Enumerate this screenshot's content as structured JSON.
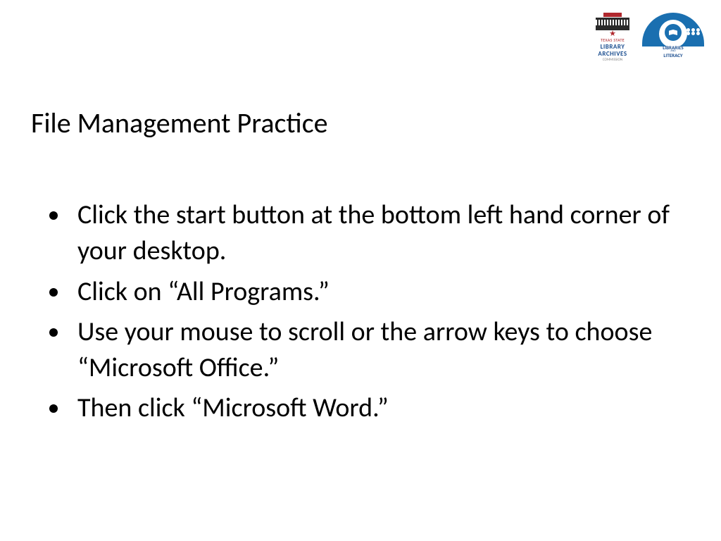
{
  "logos": {
    "tsla": {
      "line1": "TEXAS STATE",
      "line2a": "LIBRARY",
      "line2b": "ARCHIVES",
      "line3": "COMMISSION"
    },
    "ll": {
      "line1": "LIBRARIES",
      "line2": "AND",
      "line3": "LITERACY"
    }
  },
  "title": "File Management Practice",
  "bullets": [
    "Click the start button at the bottom left hand corner of your desktop.",
    "Click on “All Programs.”",
    "Use your mouse to scroll or the arrow keys to choose “Microsoft Office.”",
    "Then click “Microsoft Word.”"
  ]
}
